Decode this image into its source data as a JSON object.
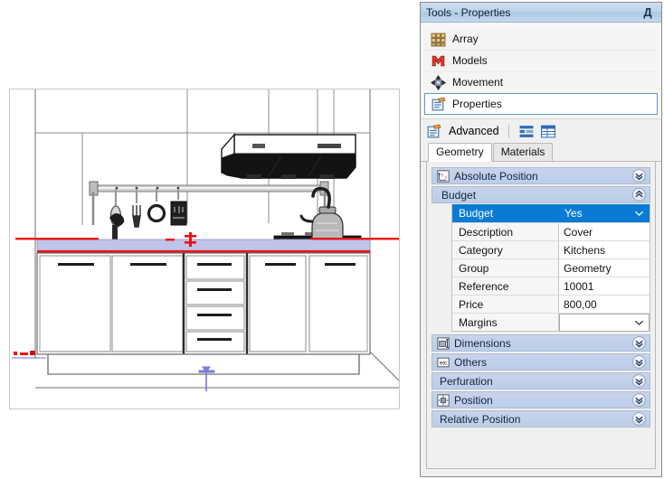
{
  "panel": {
    "title": "Tools - Properties",
    "pin_icon": "pin-icon",
    "pin_glyph": "Д"
  },
  "nav": {
    "items": [
      {
        "label": "Array",
        "icon": "array-icon",
        "selected": false
      },
      {
        "label": "Models",
        "icon": "models-icon",
        "selected": false
      },
      {
        "label": "Movement",
        "icon": "movement-icon",
        "selected": false
      },
      {
        "label": "Properties",
        "icon": "properties-icon",
        "selected": true
      }
    ]
  },
  "advanced": {
    "label": "Advanced",
    "icon": "advanced-properties-icon",
    "view_categorized_icon": "categorized-view-icon",
    "view_alphabetical_icon": "alphabetical-view-icon"
  },
  "tabs": [
    {
      "label": "Geometry",
      "active": true
    },
    {
      "label": "Materials",
      "active": false
    }
  ],
  "property_grid": {
    "sections_top": [
      {
        "label": "Absolute Position",
        "icon": "absolute-position-icon",
        "expanded": false,
        "chevron": "»"
      }
    ],
    "budget_group": {
      "label": "Budget",
      "expanded": true,
      "chevron": "«",
      "rows": [
        {
          "name": "Budget",
          "value": "Yes",
          "type": "combo",
          "selected": true
        },
        {
          "name": "Description",
          "value": "Cover",
          "type": "text",
          "selected": false
        },
        {
          "name": "Category",
          "value": "Kitchens",
          "type": "text",
          "selected": false
        },
        {
          "name": "Group",
          "value": "Geometry",
          "type": "text",
          "selected": false
        },
        {
          "name": "Reference",
          "value": "10001",
          "type": "text",
          "selected": false
        },
        {
          "name": "Price",
          "value": "800,00",
          "type": "text",
          "selected": false
        },
        {
          "name": "Margins",
          "value": "",
          "type": "combo",
          "selected": false
        }
      ]
    },
    "sections_bottom": [
      {
        "label": "Dimensions",
        "icon": "dimensions-icon",
        "expanded": false,
        "chevron": "»"
      },
      {
        "label": "Others",
        "icon": "others-etc-icon",
        "expanded": false,
        "chevron": "»"
      },
      {
        "label": "Perfuration",
        "icon": "",
        "expanded": false,
        "chevron": "»"
      },
      {
        "label": "Position",
        "icon": "position-icon",
        "expanded": false,
        "chevron": "»"
      },
      {
        "label": "Relative Position",
        "icon": "",
        "expanded": false,
        "chevron": "»"
      }
    ]
  },
  "canvas": {
    "name": "kitchen-elevation-drawing",
    "description": "2D elevation view of a kitchen run: wall cabinets area, range hood, hanging utensil rail, countertop (selected, highlighted), base cabinets with doors and drawers, faucet, cooktop and kettle.",
    "selection_highlight_color": "#bfc4e8",
    "selection_marker_color": "#ee1111",
    "anchor_marker_color": "#7a7ae0",
    "objects": [
      "range-hood",
      "utensil-rail",
      "ladle",
      "fork",
      "ring-utensil",
      "grater",
      "faucet",
      "cooktop",
      "kettle",
      "countertop",
      "cabinet-door-1",
      "cabinet-door-2",
      "drawer-1",
      "drawer-2",
      "drawer-3",
      "drawer-4",
      "cabinet-door-3",
      "cabinet-door-4",
      "plinth",
      "floor-line",
      "wall-line"
    ]
  },
  "colors": {
    "accent": "#0a7bd4",
    "panel_header": "#bcd3ea",
    "section_bar": "#bccdea",
    "selection_red": "#ee1111",
    "countertop": "#bfc4e8"
  }
}
